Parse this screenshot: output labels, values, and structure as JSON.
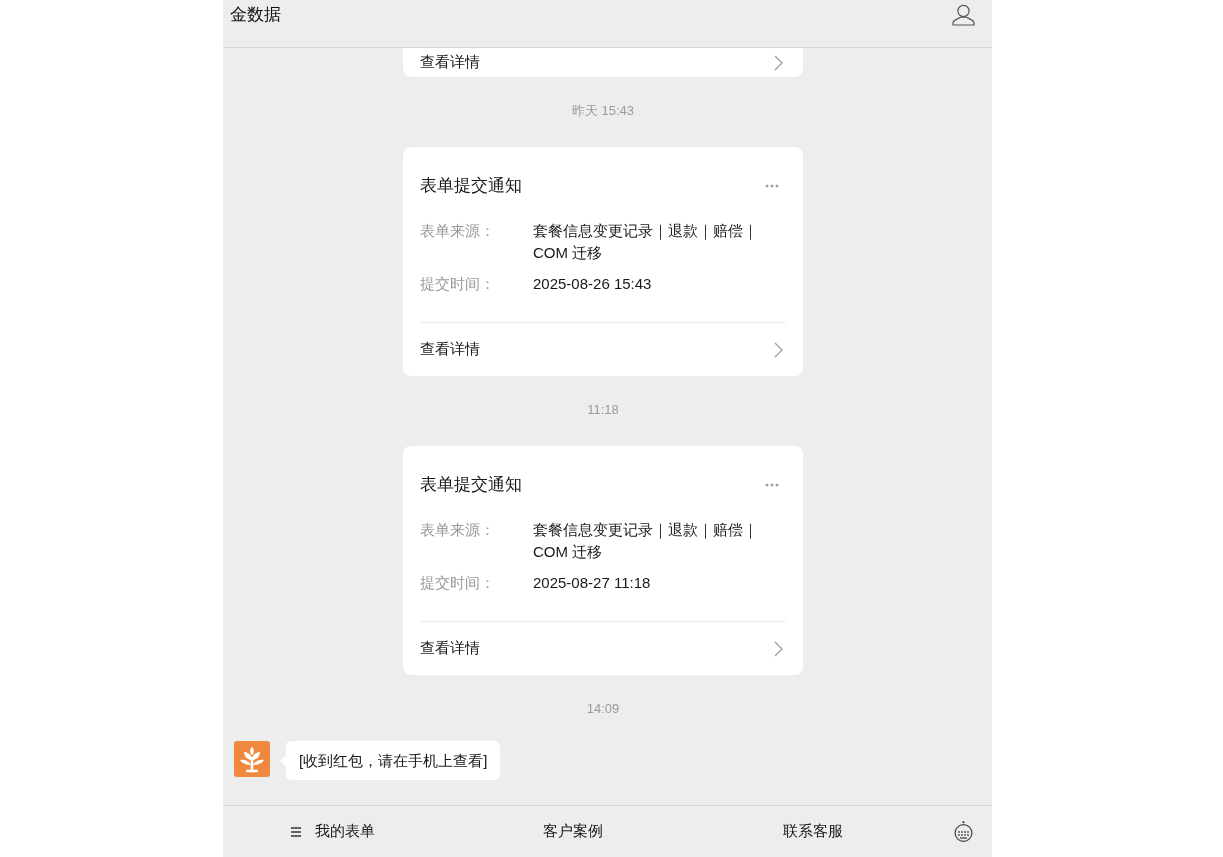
{
  "header": {
    "title": "金数据"
  },
  "messages": [
    {
      "kind": "card_tail",
      "link": "查看详情"
    },
    {
      "kind": "time",
      "text": "昨天 15:43"
    },
    {
      "kind": "form_card",
      "title": "表单提交通知",
      "fields": [
        {
          "label": "表单来源：",
          "value": "套餐信息变更记录｜退款｜赔偿｜COM 迁移"
        },
        {
          "label": "提交时间：",
          "value": "2025-08-26 15:43"
        }
      ],
      "link": "查看详情"
    },
    {
      "kind": "time",
      "text": "11:18"
    },
    {
      "kind": "form_card",
      "title": "表单提交通知",
      "fields": [
        {
          "label": "表单来源：",
          "value": "套餐信息变更记录｜退款｜赔偿｜COM 迁移"
        },
        {
          "label": "提交时间：",
          "value": "2025-08-27 11:18"
        }
      ],
      "link": "查看详情"
    },
    {
      "kind": "time",
      "text": "14:09"
    },
    {
      "kind": "text",
      "text": "[收到红包，请在手机上查看]"
    }
  ],
  "menu_bar": {
    "items": [
      {
        "label": "我的表单",
        "submenu": true
      },
      {
        "label": "客户案例",
        "submenu": false
      },
      {
        "label": "联系客服",
        "submenu": false
      }
    ]
  }
}
